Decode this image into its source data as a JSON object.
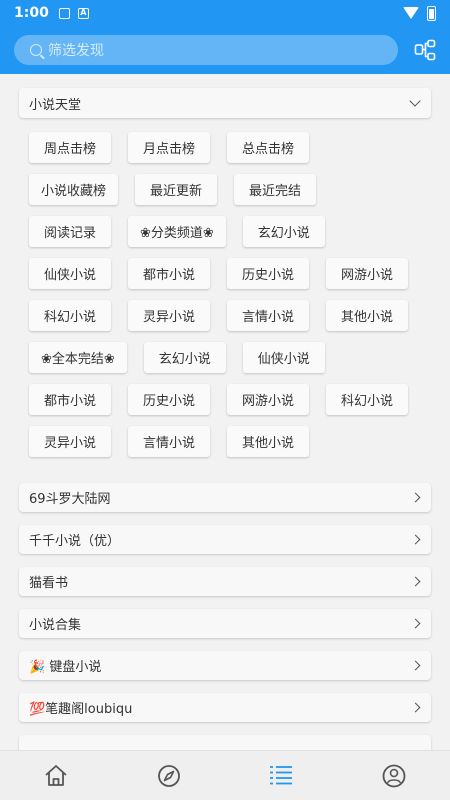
{
  "status_bar": {
    "time": "1:00",
    "icon_1": "image-icon",
    "icon_2": "A"
  },
  "app_bar": {
    "search_placeholder": "筛选发现",
    "action_icon": "share-tree-icon"
  },
  "groups": [
    {
      "title": "小说天堂",
      "expanded": true,
      "tags": [
        "周点击榜",
        "月点击榜",
        "总点击榜",
        "小说收藏榜",
        "最近更新",
        "最近完结",
        "阅读记录",
        "❀分类频道❀",
        "玄幻小说",
        "仙侠小说",
        "都市小说",
        "历史小说",
        "网游小说",
        "科幻小说",
        "灵异小说",
        "言情小说",
        "其他小说",
        "❀全本完结❀",
        "玄幻小说",
        "仙侠小说",
        "都市小说",
        "历史小说",
        "网游小说",
        "科幻小说",
        "灵异小说",
        "言情小说",
        "其他小说"
      ]
    },
    {
      "title": "69斗罗大陆网",
      "expanded": false
    },
    {
      "title": "千千小说（优）",
      "expanded": false
    },
    {
      "title": "猫看书",
      "expanded": false
    },
    {
      "title": "小说合集",
      "expanded": false
    },
    {
      "title": "🎉 键盘小说",
      "expanded": false
    },
    {
      "title": "💯笔趣阁loubiqu",
      "expanded": false
    }
  ],
  "bottom_nav": [
    {
      "name": "home",
      "icon": "home-icon"
    },
    {
      "name": "discover",
      "icon": "compass-icon"
    },
    {
      "name": "list",
      "icon": "list-icon",
      "active": true
    },
    {
      "name": "profile",
      "icon": "user-icon"
    }
  ],
  "colors": {
    "primary": "#2196f3",
    "nav_active": "#2196f3",
    "nav_inactive": "#555555"
  }
}
